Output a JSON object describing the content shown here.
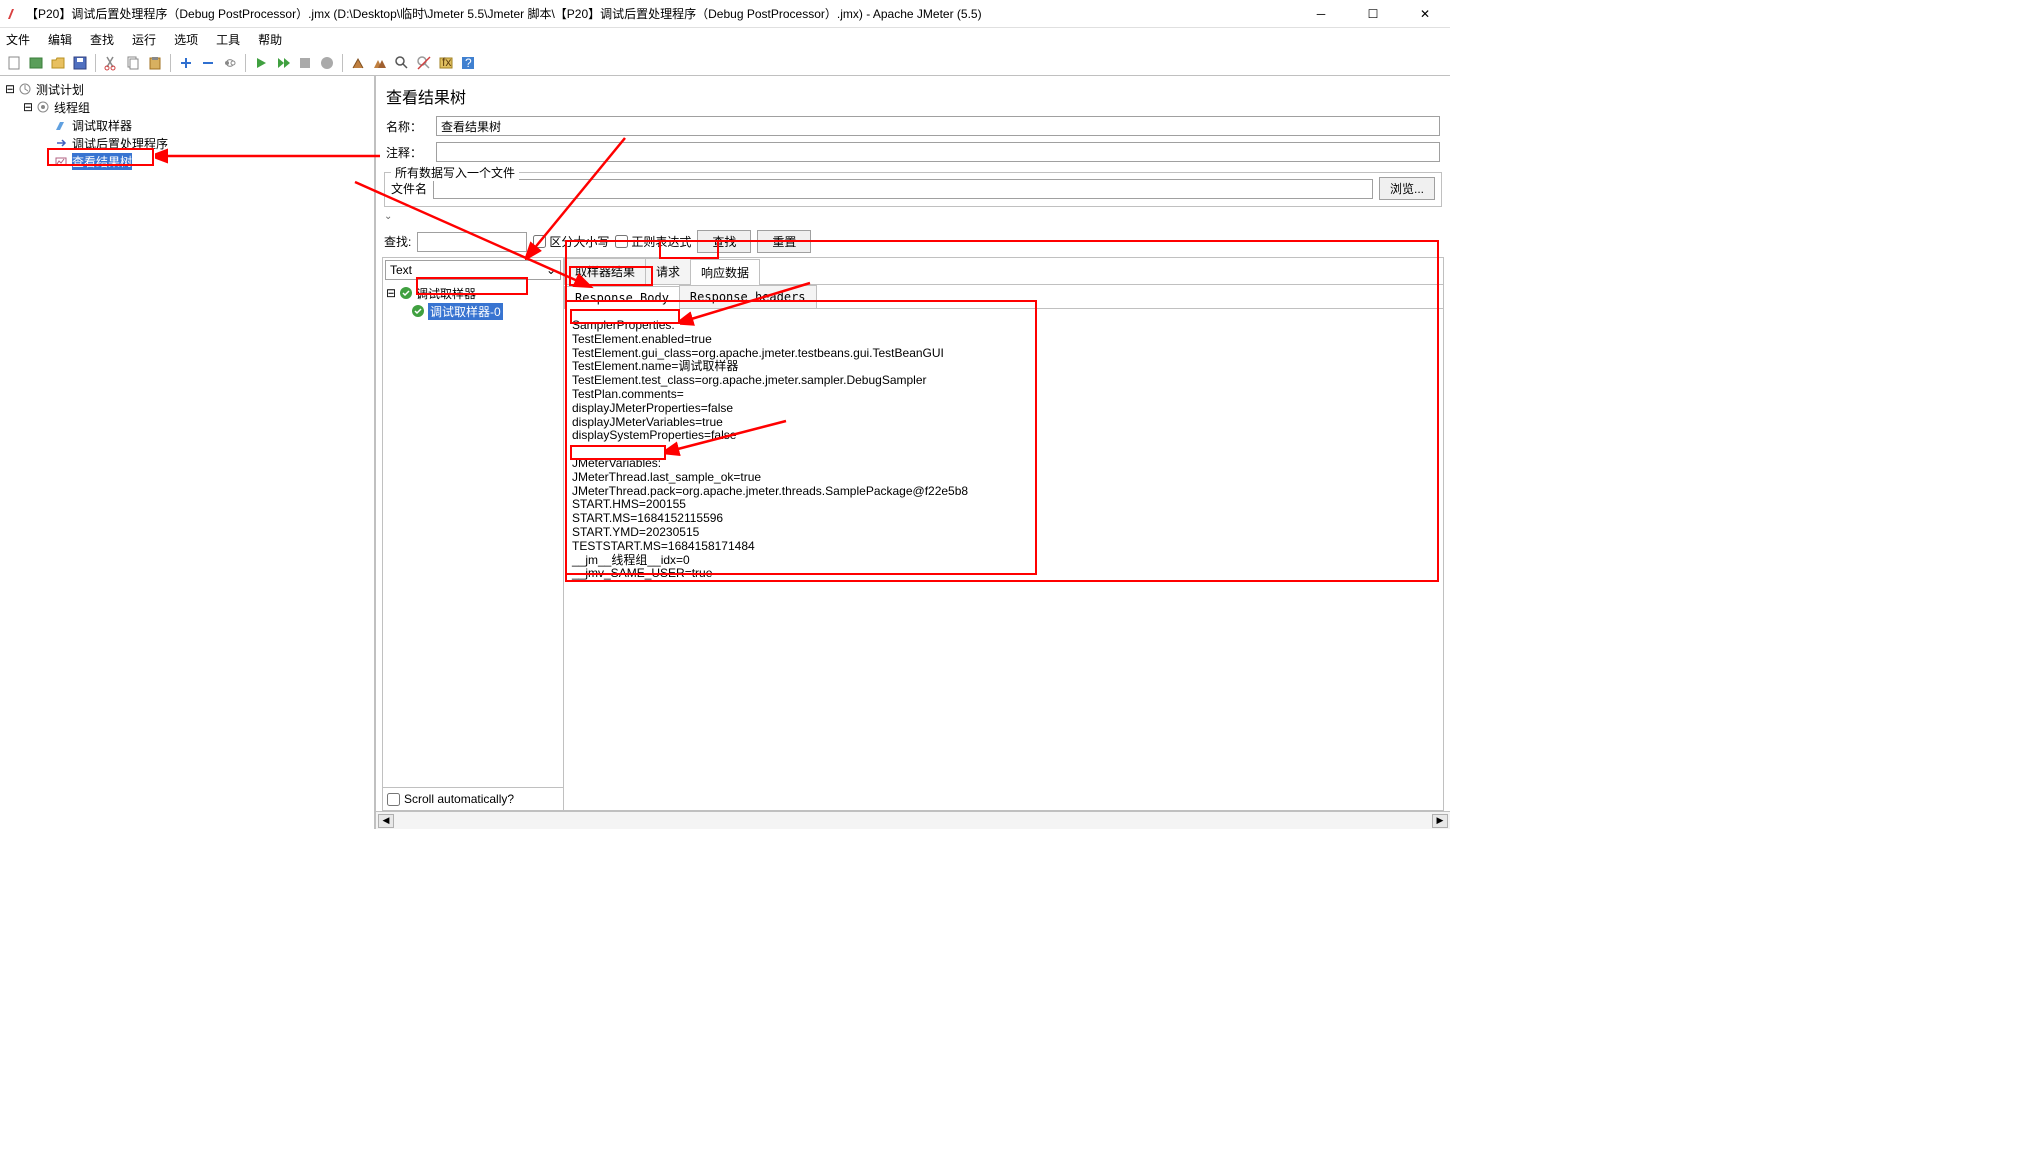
{
  "title": "【P20】调试后置处理程序（Debug PostProcessor）.jmx (D:\\Desktop\\临时\\Jmeter 5.5\\Jmeter 脚本\\【P20】调试后置处理程序（Debug PostProcessor）.jmx) - Apache JMeter (5.5)",
  "menu": {
    "file": "文件",
    "edit": "编辑",
    "search": "查找",
    "run": "运行",
    "options": "选项",
    "tools": "工具",
    "help": "帮助"
  },
  "tree": {
    "root": "测试计划",
    "threadGroup": "线程组",
    "sampler": "调试取样器",
    "postProcessor": "调试后置处理程序",
    "viewResultsTree": "查看结果树"
  },
  "panel": {
    "heading": "查看结果树",
    "nameLabel": "名称：",
    "nameValue": "查看结果树",
    "commentLabel": "注释：",
    "commentValue": "",
    "fileGroupLegend": "所有数据写入一个文件",
    "fileNameLabel": "文件名",
    "fileNameValue": "",
    "browseLabel": "浏览..."
  },
  "searchbar": {
    "label": "查找:",
    "value": "",
    "caseSensitive": "区分大小写",
    "regex": "正则表达式",
    "searchBtn": "查找",
    "resetBtn": "重置"
  },
  "combo": "Text",
  "resultTree": {
    "parent": "调试取样器",
    "child": "调试取样器-0"
  },
  "scrollAuto": "Scroll automatically?",
  "tabs1": {
    "samplerResult": "取样器结果",
    "request": "请求",
    "responseData": "响应数据"
  },
  "tabs2": {
    "responseBody": "Response Body",
    "responseHeaders": "Response headers"
  },
  "response": {
    "line1": "SamplerProperties:",
    "line2": "TestElement.enabled=true",
    "line3": "TestElement.gui_class=org.apache.jmeter.testbeans.gui.TestBeanGUI",
    "line4": "TestElement.name=调试取样器",
    "line5": "TestElement.test_class=org.apache.jmeter.sampler.DebugSampler",
    "line6": "TestPlan.comments=",
    "line7": "displayJMeterProperties=false",
    "line8": "displayJMeterVariables=true",
    "line9": "displaySystemProperties=false",
    "line10": "",
    "line11": "JMeterVariables:",
    "line12": "JMeterThread.last_sample_ok=true",
    "line13": "JMeterThread.pack=org.apache.jmeter.threads.SamplePackage@f22e5b8",
    "line14": "START.HMS=200155",
    "line15": "START.MS=1684152115596",
    "line16": "START.YMD=20230515",
    "line17": "TESTSTART.MS=1684158171484",
    "line18": "__jm__线程组__idx=0",
    "line19": "__jmv_SAME_USER=true"
  }
}
